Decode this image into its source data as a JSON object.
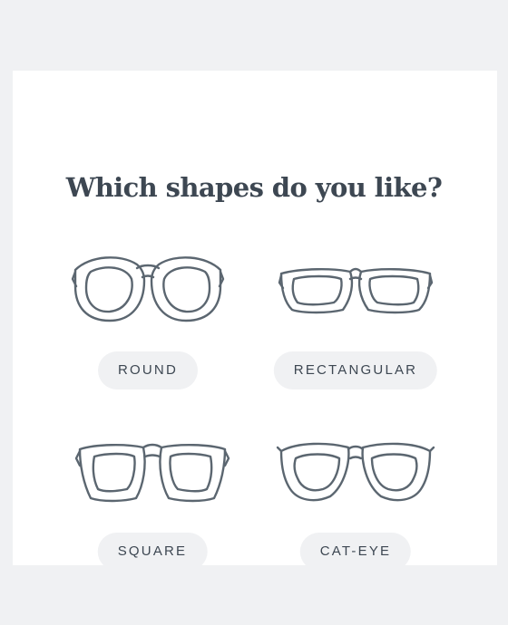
{
  "quiz": {
    "question": "Which shapes do you like?",
    "options": [
      {
        "label": "ROUND",
        "icon": "round-glasses-icon"
      },
      {
        "label": "RECTANGULAR",
        "icon": "rectangular-glasses-icon"
      },
      {
        "label": "SQUARE",
        "icon": "square-glasses-icon"
      },
      {
        "label": "CAT-EYE",
        "icon": "cat-eye-glasses-icon"
      }
    ]
  },
  "colors": {
    "page_background": "#f0f1f3",
    "card_background": "#ffffff",
    "heading_text": "#3d4752",
    "frame_stroke": "#5b6670",
    "pill_background": "#f0f1f3"
  }
}
